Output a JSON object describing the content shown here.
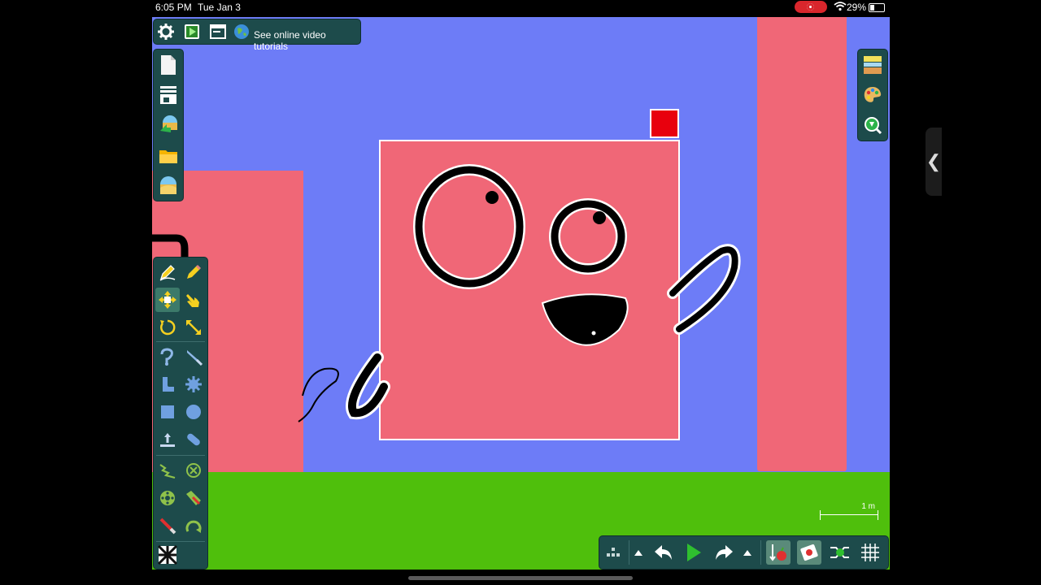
{
  "status_bar": {
    "time": "6:05 PM",
    "date": "Tue Jan 3",
    "battery": "29%"
  },
  "top_toolbar": {
    "tutorial_label": "See online video tutorials"
  },
  "scale_bar": {
    "label": "1 m"
  },
  "colors": {
    "background": "#6d7cf7",
    "ground": "#4fbf0c",
    "box": "#f06777",
    "toolbar": "#1d4b4b",
    "marker": "#e8000d"
  }
}
